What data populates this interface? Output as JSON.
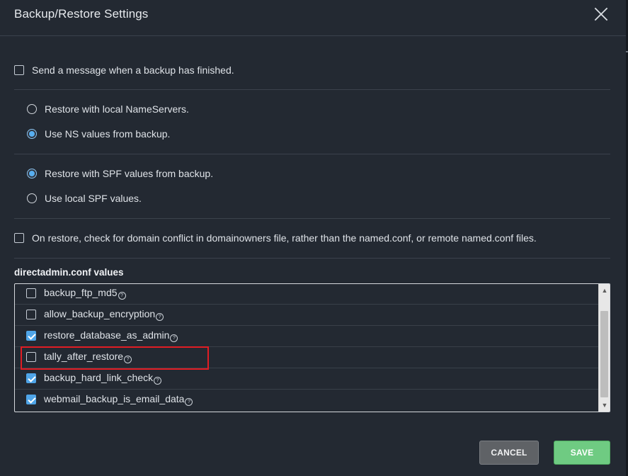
{
  "dialog": {
    "title": "Backup/Restore Settings"
  },
  "options": {
    "send_message": {
      "label": "Send a message when a backup has finished.",
      "checked": false
    },
    "ns_group": [
      {
        "label": "Restore with local NameServers.",
        "selected": false
      },
      {
        "label": "Use NS values from backup.",
        "selected": true
      }
    ],
    "spf_group": [
      {
        "label": "Restore with SPF values from backup.",
        "selected": true
      },
      {
        "label": "Use local SPF values.",
        "selected": false
      }
    ],
    "domain_conflict": {
      "label": "On restore, check for domain conflict in domainowners file, rather than the named.conf, or remote named.conf files.",
      "checked": false
    }
  },
  "conf": {
    "title": "directadmin.conf values",
    "items": [
      {
        "label": "backup_ftp_md5",
        "checked": false
      },
      {
        "label": "allow_backup_encryption",
        "checked": false
      },
      {
        "label": "restore_database_as_admin",
        "checked": true
      },
      {
        "label": "tally_after_restore",
        "checked": false
      },
      {
        "label": "backup_hard_link_check",
        "checked": true
      },
      {
        "label": "webmail_backup_is_email_data",
        "checked": true
      }
    ],
    "help_glyph": "?"
  },
  "buttons": {
    "cancel": "CANCEL",
    "save": "SAVE"
  },
  "icons": {
    "close": "close-icon",
    "help": "help-circle-icon",
    "scroll_up": "chevron-up-icon",
    "scroll_down": "chevron-down-icon"
  },
  "colors": {
    "background": "#232932",
    "accent": "#58aff1",
    "save": "#6fcb82",
    "cancel": "#5f6266",
    "highlight": "#e11d24"
  }
}
